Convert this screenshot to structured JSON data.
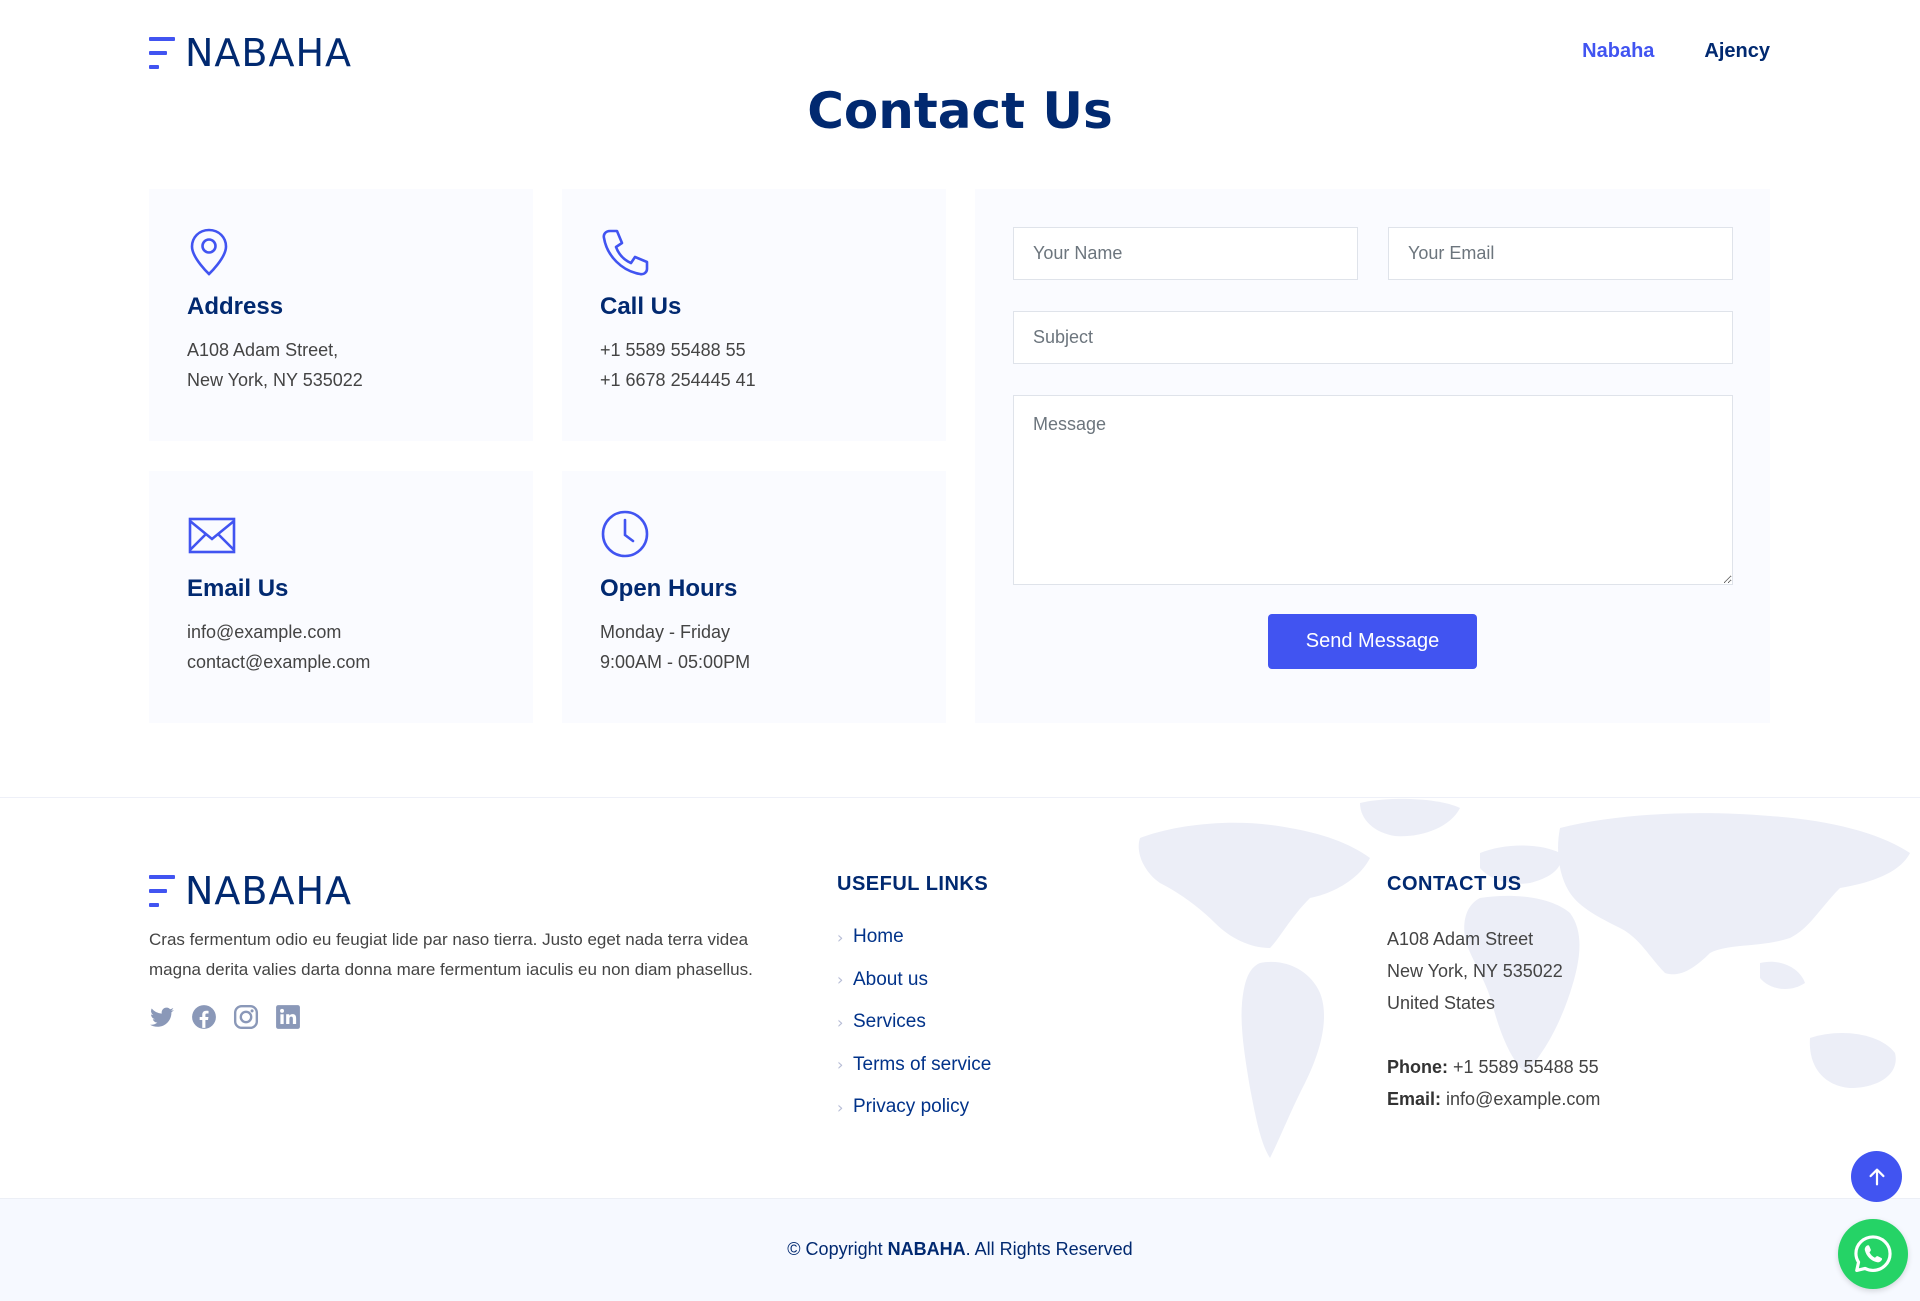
{
  "brand": {
    "name": "NABAHA",
    "accent_color": "#4154f1",
    "dark_color": "#012970"
  },
  "nav": {
    "items": [
      {
        "label": "Nabaha",
        "active": true
      },
      {
        "label": "Ajency",
        "active": false
      }
    ]
  },
  "page": {
    "title": "Contact Us"
  },
  "info_boxes": [
    {
      "icon": "map-pin-icon",
      "title": "Address",
      "lines": [
        "A108 Adam Street,",
        "New York, NY 535022"
      ]
    },
    {
      "icon": "phone-icon",
      "title": "Call Us",
      "lines": [
        "+1 5589 55488 55",
        "+1 6678 254445 41"
      ]
    },
    {
      "icon": "envelope-icon",
      "title": "Email Us",
      "lines": [
        "info@example.com",
        "contact@example.com"
      ]
    },
    {
      "icon": "clock-icon",
      "title": "Open Hours",
      "lines": [
        "Monday - Friday",
        "9:00AM - 05:00PM"
      ]
    }
  ],
  "form": {
    "name_placeholder": "Your Name",
    "email_placeholder": "Your Email",
    "subject_placeholder": "Subject",
    "message_placeholder": "Message",
    "submit_label": "Send Message"
  },
  "footer": {
    "description": "Cras fermentum odio eu feugiat lide par naso tierra. Justo eget nada terra videa magna derita valies darta donna mare fermentum iaculis eu non diam phasellus.",
    "social": [
      "twitter-icon",
      "facebook-icon",
      "instagram-icon",
      "linkedin-icon"
    ],
    "useful_links_title": "USEFUL LINKS",
    "useful_links": [
      "Home",
      "About us",
      "Services",
      "Terms of service",
      "Privacy policy"
    ],
    "contact_title": "CONTACT US",
    "contact_address": [
      "A108 Adam Street",
      "New York, NY 535022",
      "United States"
    ],
    "phone_label": "Phone:",
    "phone": "+1 5589 55488 55",
    "email_label": "Email:",
    "email": "info@example.com"
  },
  "copyright": {
    "prefix": "© Copyright",
    "brand": "NABAHA",
    "suffix": ". All Rights Reserved"
  }
}
